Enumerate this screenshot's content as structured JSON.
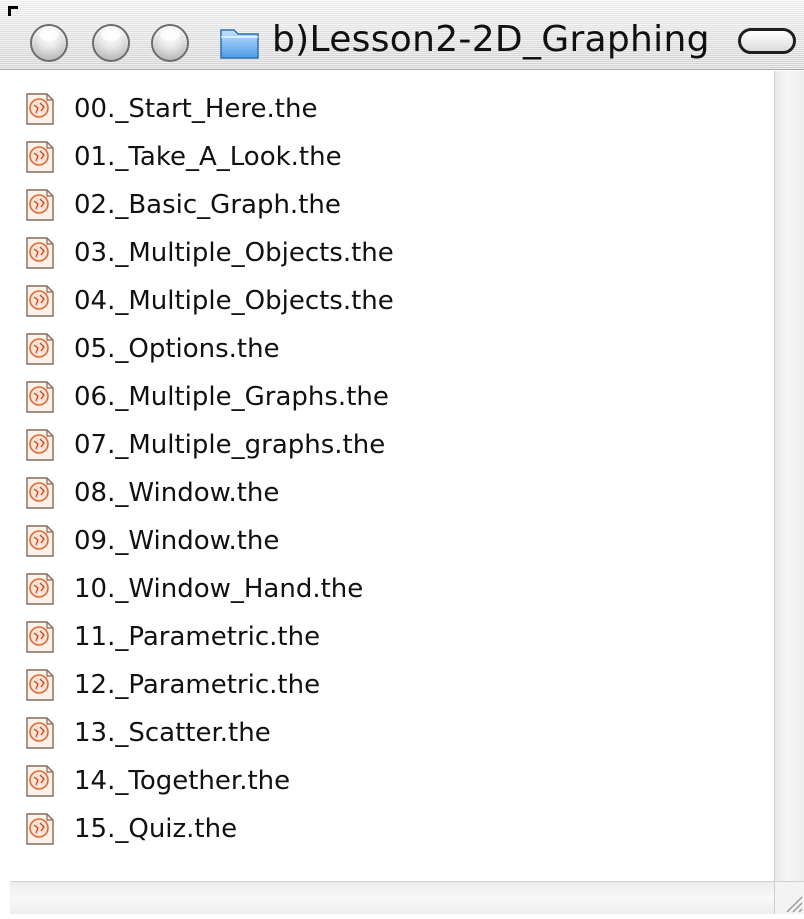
{
  "window": {
    "title": "b)Lesson2-2D_Graphing",
    "folder_icon": "folder-icon"
  },
  "file_icon": "graph-document-icon",
  "files": [
    {
      "name": "00._Start_Here.the"
    },
    {
      "name": "01._Take_A_Look.the"
    },
    {
      "name": "02._Basic_Graph.the"
    },
    {
      "name": "03._Multiple_Objects.the"
    },
    {
      "name": "04._Multiple_Objects.the"
    },
    {
      "name": "05._Options.the"
    },
    {
      "name": "06._Multiple_Graphs.the"
    },
    {
      "name": "07._Multiple_graphs.the"
    },
    {
      "name": "08._Window.the"
    },
    {
      "name": "09._Window.the"
    },
    {
      "name": "10._Window_Hand.the"
    },
    {
      "name": "11._Parametric.the"
    },
    {
      "name": "12._Parametric.the"
    },
    {
      "name": "13._Scatter.the"
    },
    {
      "name": "14._Together.the"
    },
    {
      "name": "15._Quiz.the"
    }
  ]
}
